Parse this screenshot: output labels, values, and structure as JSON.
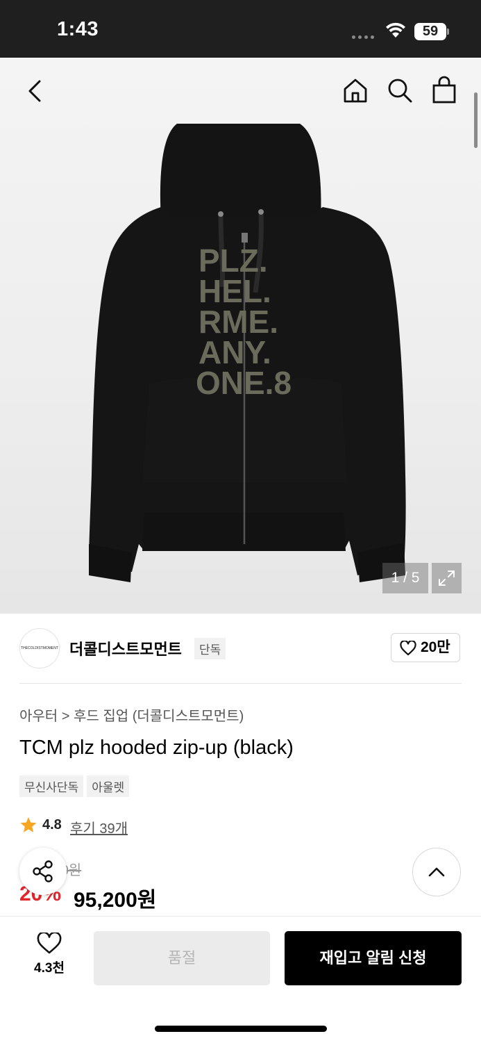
{
  "status_bar": {
    "time": "1:43",
    "battery": "59"
  },
  "gallery": {
    "counter": "1 / 5",
    "print_text": [
      "PLZ.",
      "HEL.",
      "RME.",
      "ANY.",
      "ONE.8"
    ]
  },
  "brand": {
    "logo_text": "THECOLDISTMOMENT",
    "name": "더콜디스트모먼트",
    "tag": "단독",
    "likes": "20만"
  },
  "product": {
    "breadcrumb": "아우터 > 후드 집업 (더콜디스트모먼트)",
    "title": "TCM plz hooded zip-up (black)",
    "tags": [
      "무신사단독",
      "아울렛"
    ],
    "rating": "4.8",
    "reviews": "후기 39개",
    "original_price": "119,000원",
    "discount": "20%",
    "price": "95,200원"
  },
  "bottom_bar": {
    "wishlist_count": "4.3천",
    "soldout_label": "품절",
    "restock_label": "재입고 알림 신청"
  },
  "colors": {
    "accent_red": "#e3262b",
    "primary_black": "#000000",
    "disabled_gray": "#ebebeb"
  },
  "icons": [
    "back-icon",
    "home-icon",
    "search-icon",
    "cart-icon",
    "expand-icon",
    "heart-icon",
    "star-icon",
    "share-icon",
    "chevron-up-icon"
  ]
}
